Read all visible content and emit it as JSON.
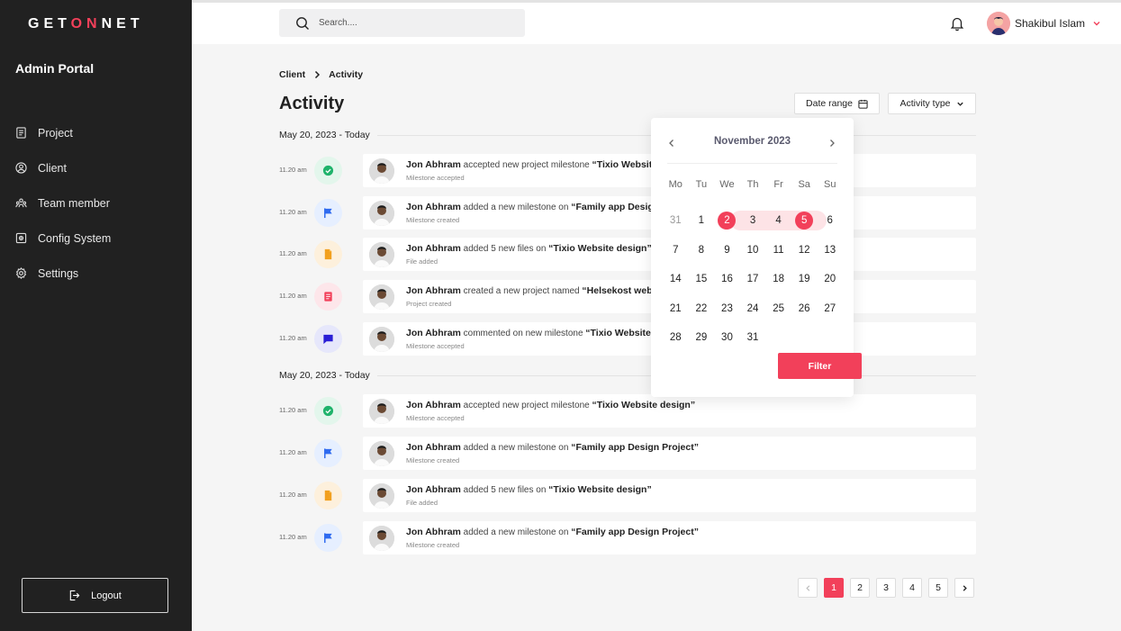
{
  "brand": {
    "prefix": "GET",
    "accent": "ON",
    "suffix": "NET",
    "accent_color": "#f2405a"
  },
  "sidebar": {
    "title": "Admin Portal",
    "items": [
      {
        "label": "Project",
        "icon": "document-icon"
      },
      {
        "label": "Client",
        "icon": "user-circle-icon"
      },
      {
        "label": "Team member",
        "icon": "team-icon"
      },
      {
        "label": "Config System",
        "icon": "config-icon"
      },
      {
        "label": "Settings",
        "icon": "gear-icon"
      }
    ],
    "logout_label": "Logout"
  },
  "header": {
    "search_placeholder": "Search....",
    "user_name": "Shakibul Islam"
  },
  "breadcrumb": {
    "parent": "Client",
    "current": "Activity"
  },
  "page": {
    "title": "Activity",
    "date_range_label": "Date range",
    "activity_type_label": "Activity type"
  },
  "groups": [
    {
      "title": "May 20, 2023 - Today",
      "rows": [
        {
          "time": "11.20 am",
          "type": "check",
          "who": "Jon Abhram",
          "action": "accepted new project milestone",
          "object": "“Tixio Website design”",
          "sub": "Milestone accepted"
        },
        {
          "time": "11.20 am",
          "type": "flag",
          "who": "Jon Abhram",
          "action": "added a new milestone on",
          "object": "“Family app Design Project”",
          "sub": "Milestone created"
        },
        {
          "time": "11.20 am",
          "type": "file",
          "who": "Jon Abhram",
          "action": "added 5 new files on",
          "object": "“Tixio Website design”",
          "sub": "File added"
        },
        {
          "time": "11.20 am",
          "type": "doc",
          "who": "Jon Abhram",
          "action": "created a new project named",
          "object": "“Helsekost website”",
          "sub": "Project created"
        },
        {
          "time": "11.20 am",
          "type": "comment",
          "who": "Jon Abhram",
          "action": "commented on new milestone",
          "object": "“Tixio Website design”",
          "sub": "Milestone accepted"
        }
      ]
    },
    {
      "title": "May 20, 2023 - Today",
      "rows": [
        {
          "time": "11.20 am",
          "type": "check",
          "who": "Jon Abhram",
          "action": "accepted new project milestone",
          "object": "“Tixio Website design”",
          "sub": "Milestone accepted"
        },
        {
          "time": "11.20 am",
          "type": "flag",
          "who": "Jon Abhram",
          "action": "added a new milestone on",
          "object": "“Family app Design Project”",
          "sub": "Milestone created"
        },
        {
          "time": "11.20 am",
          "type": "file",
          "who": "Jon Abhram",
          "action": "added 5 new files on",
          "object": "“Tixio Website design”",
          "sub": "File added"
        },
        {
          "time": "11.20 am",
          "type": "flag",
          "who": "Jon Abhram",
          "action": "added a new milestone on",
          "object": "“Family app Design Project”",
          "sub": "Milestone created"
        }
      ]
    }
  ],
  "calendar": {
    "month": "November 2023",
    "weekdays": [
      "Mo",
      "Tu",
      "We",
      "Th",
      "Fr",
      "Sa",
      "Su"
    ],
    "weeks": [
      [
        "31",
        "1",
        "2",
        "3",
        "4",
        "5",
        "6"
      ],
      [
        "7",
        "8",
        "9",
        "10",
        "11",
        "12",
        "13"
      ],
      [
        "14",
        "15",
        "16",
        "17",
        "18",
        "19",
        "20"
      ],
      [
        "21",
        "22",
        "23",
        "24",
        "25",
        "26",
        "27"
      ],
      [
        "28",
        "29",
        "30",
        "31",
        "",
        "",
        ""
      ]
    ],
    "muted_day": "31",
    "selected_start": "2",
    "selected_end": "5",
    "filter_label": "Filter"
  },
  "pagination": {
    "pages": [
      "1",
      "2",
      "3",
      "4",
      "5"
    ],
    "active": "1"
  },
  "colors": {
    "check_bg": "#e3f6ec",
    "check_fg": "#1fb36b",
    "flag_bg": "#e6efff",
    "flag_fg": "#2f6bf0",
    "file_bg": "#fdf0dc",
    "file_fg": "#f2a01e",
    "doc_bg": "#fde6ea",
    "doc_fg": "#f2405a",
    "comment_bg": "#e6e7fb",
    "comment_fg": "#2a1fd6"
  }
}
